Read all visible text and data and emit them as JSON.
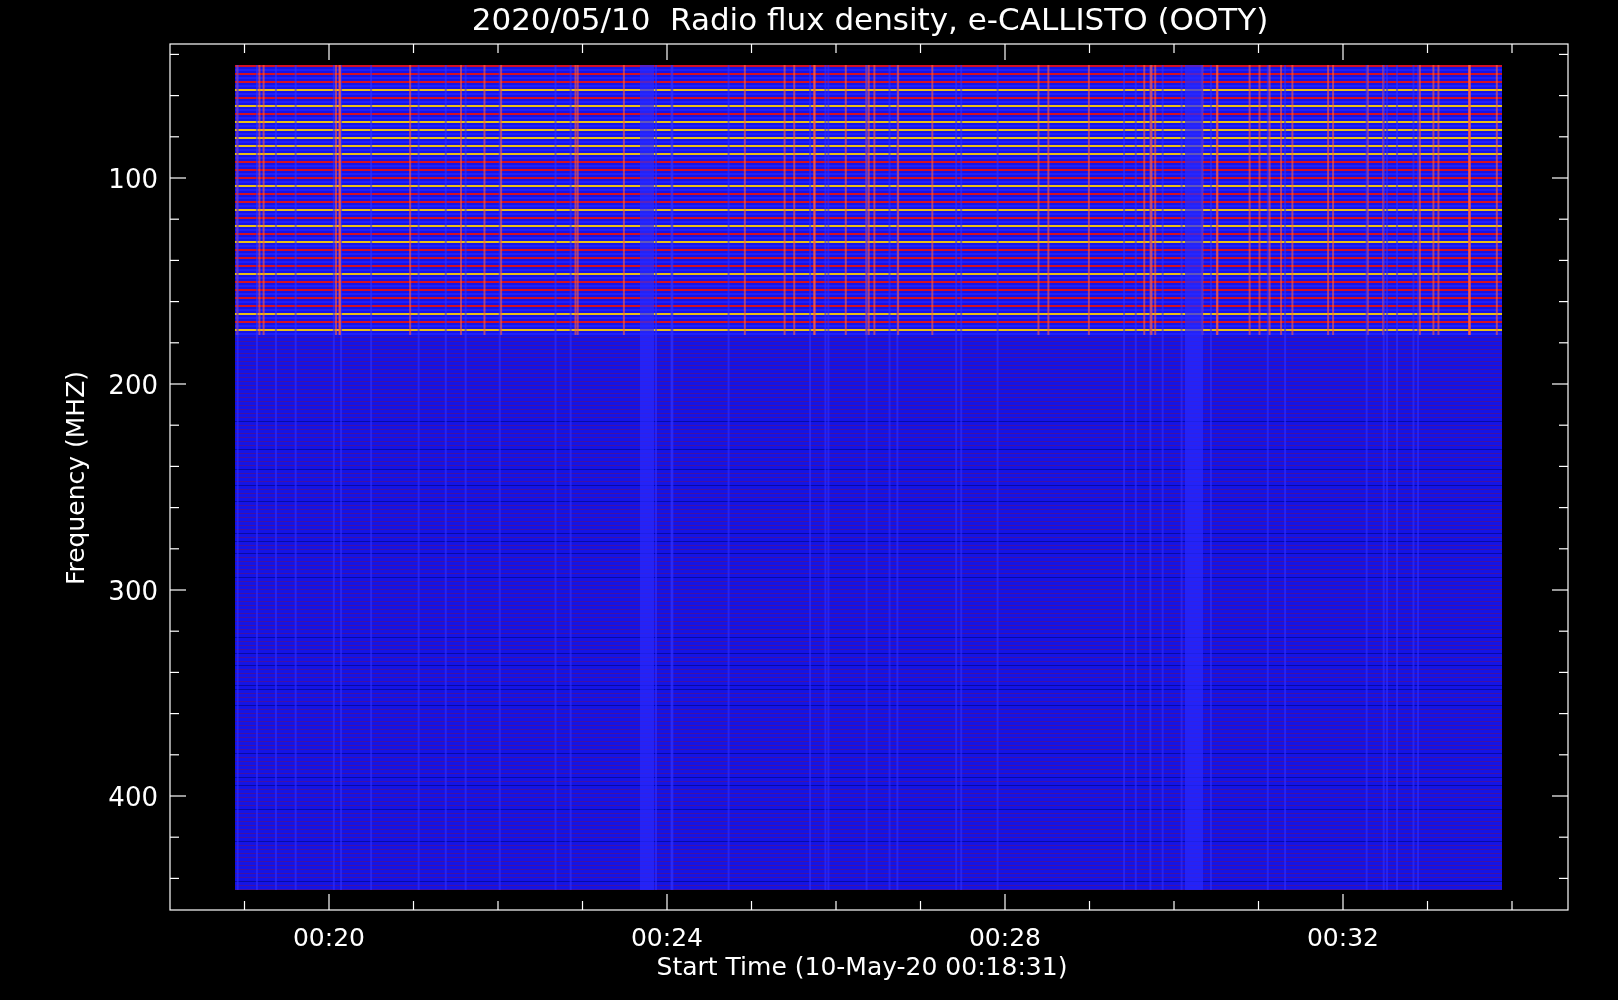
{
  "plot": {
    "title": "2020/05/10  Radio flux density, e-CALLISTO (OOTY)",
    "ylabel": "Frequency (MHZ)",
    "xlabel": "Start Time (10-May-20 00:18:31)",
    "yticks": [
      "100",
      "200",
      "300",
      "400"
    ],
    "xticks": [
      "00:20",
      "00:24",
      "00:28",
      "00:32"
    ]
  }
}
